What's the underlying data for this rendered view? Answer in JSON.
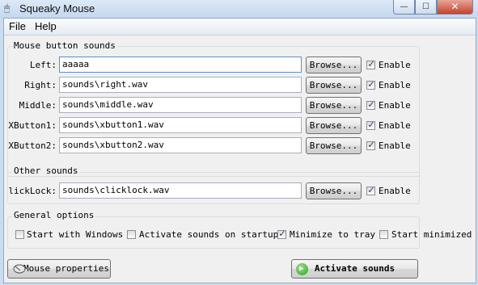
{
  "window": {
    "title": "Squeaky Mouse",
    "minimize_glyph": "—",
    "maximize_glyph": "☐",
    "close_glyph": "✕"
  },
  "menu": [
    "File",
    "Help"
  ],
  "mouse_buttons": {
    "title": "Mouse button sounds",
    "rows": [
      {
        "label": "Left:",
        "value": "aaaaa",
        "browse": "Browse...",
        "enable": "Enable",
        "checked": true
      },
      {
        "label": "Right:",
        "value": "sounds\\right.wav",
        "browse": "Browse...",
        "enable": "Enable",
        "checked": true
      },
      {
        "label": "Middle:",
        "value": "sounds\\middle.wav",
        "browse": "Browse...",
        "enable": "Enable",
        "checked": true
      },
      {
        "label": "XButton1:",
        "value": "sounds\\xbutton1.wav",
        "browse": "Browse...",
        "enable": "Enable",
        "checked": true
      },
      {
        "label": "XButton2:",
        "value": "sounds\\xbutton2.wav",
        "browse": "Browse...",
        "enable": "Enable",
        "checked": true
      }
    ]
  },
  "other_sounds": {
    "title": "Other sounds",
    "row": {
      "label": "lickLock:",
      "value": "sounds\\clicklock.wav",
      "browse": "Browse...",
      "enable": "Enable",
      "checked": true
    }
  },
  "general": {
    "title": "General options",
    "options": [
      {
        "label": "Start with Windows",
        "checked": false
      },
      {
        "label": "Activate sounds on startup",
        "checked": false
      },
      {
        "label": "Minimize to tray",
        "checked": true
      },
      {
        "label": "Start minimized",
        "checked": false
      }
    ]
  },
  "footer": {
    "mouse_properties": "Mouse properties",
    "activate_sounds": "Activate sounds"
  },
  "icons": {
    "app": "mouse-icon",
    "mouse_properties": "mouse-icon",
    "activate": "play-icon"
  },
  "colors": {
    "frame": "#c9dcf0",
    "close_button": "#c4422f",
    "activate_icon": "#2e9b27"
  }
}
